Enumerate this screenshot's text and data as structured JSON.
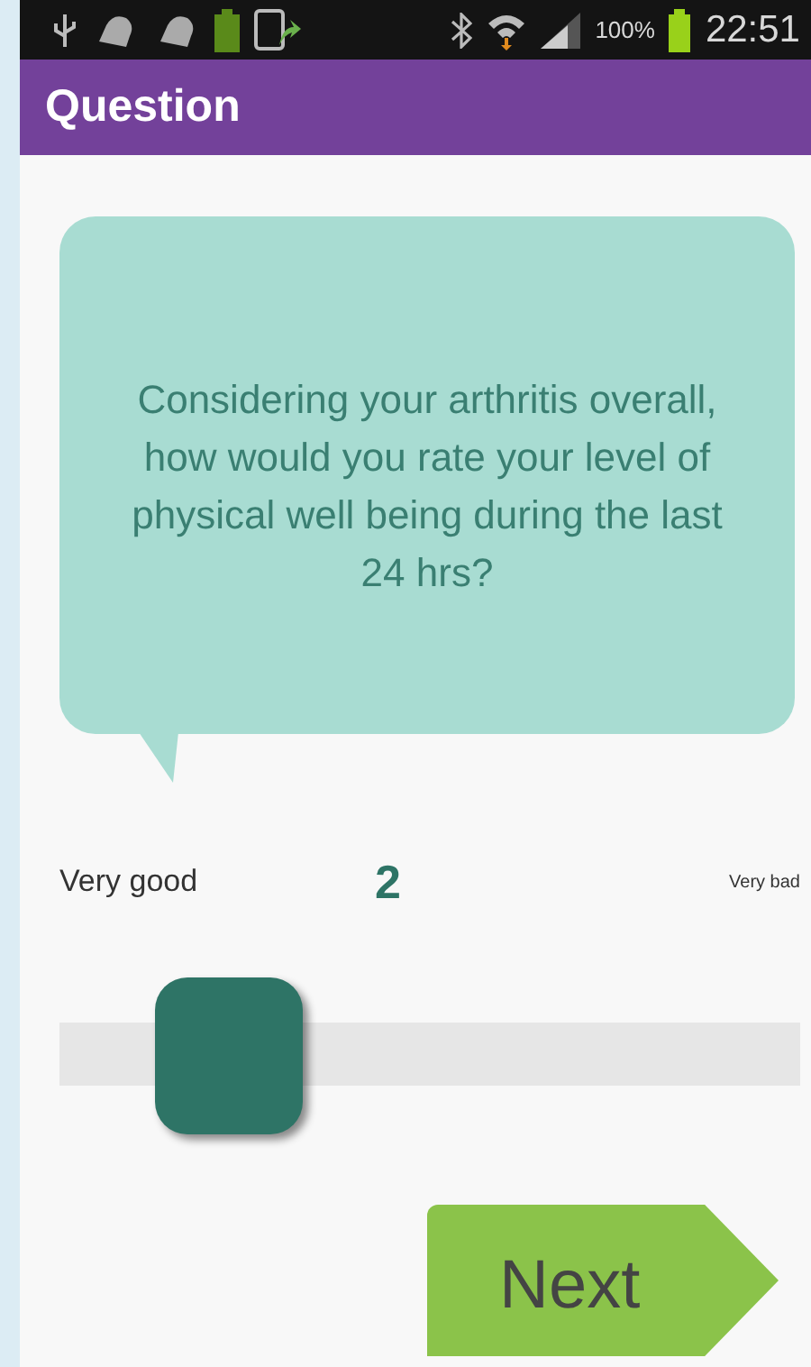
{
  "status_bar": {
    "battery_percent": "100%",
    "time": "22:51"
  },
  "app_bar": {
    "title": "Question"
  },
  "question": {
    "text": "Considering your arthritis overall, how would you rate your level of physical well being during the last 24 hrs?"
  },
  "scale": {
    "min_label": "Very good",
    "value": "2",
    "max_label": "Very bad",
    "level": 0.16
  },
  "next_button": {
    "label": "Next"
  }
}
